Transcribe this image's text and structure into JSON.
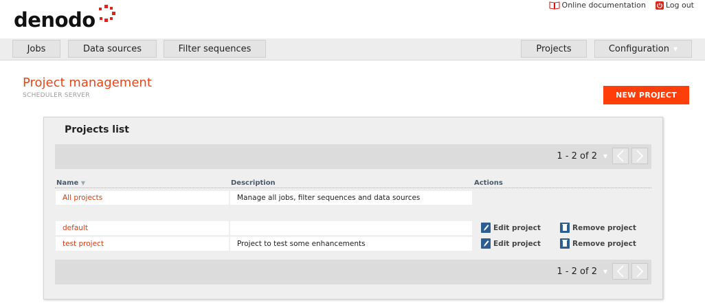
{
  "header": {
    "logo_text": "denodo",
    "links": {
      "documentation": "Online documentation",
      "logout": "Log out"
    }
  },
  "nav": {
    "left": [
      "Jobs",
      "Data sources",
      "Filter sequences"
    ],
    "right": [
      "Projects",
      "Configuration"
    ]
  },
  "page": {
    "title": "Project management",
    "subtitle": "SCHEDULER SERVER",
    "new_button": "NEW PROJECT"
  },
  "panel": {
    "title": "Projects list",
    "pager_top": "1 - 2 of 2",
    "pager_bottom": "1 - 2 of 2",
    "columns": {
      "name": "Name",
      "description": "Description",
      "actions": "Actions"
    },
    "all_projects": {
      "name": "All projects",
      "description": "Manage all jobs, filter sequences and data sources"
    },
    "rows": [
      {
        "name": "default",
        "description": "",
        "edit": "Edit project",
        "remove": "Remove project"
      },
      {
        "name": "test project",
        "description": "Project to test some enhancements",
        "edit": "Edit project",
        "remove": "Remove project"
      }
    ]
  },
  "colors": {
    "accent": "#ff3e0a",
    "title": "#e8461a",
    "link": "#d63d13"
  }
}
